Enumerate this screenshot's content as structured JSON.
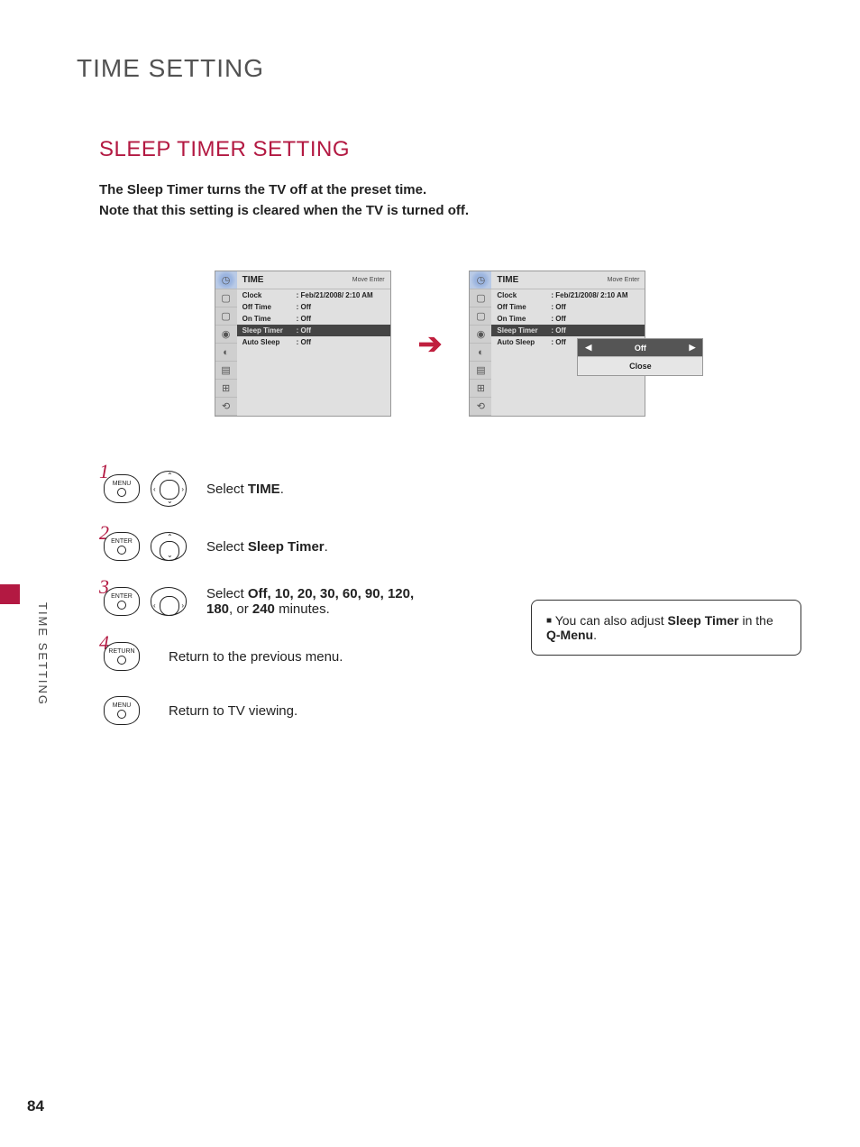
{
  "page_number": "84",
  "title": "TIME SETTING",
  "subtitle": "SLEEP TIMER SETTING",
  "side_label": "TIME SETTING",
  "description_line1": "The Sleep Timer turns the TV off at the preset time.",
  "description_line2": "Note that this setting is cleared when the TV is turned off.",
  "osd": {
    "header": "TIME",
    "header_nav": "Move    Enter",
    "rows": [
      {
        "label": "Clock",
        "value": "Feb/21/2008/ 2:10 AM"
      },
      {
        "label": "Off Time",
        "value": "Off"
      },
      {
        "label": "On Time",
        "value": "Off"
      },
      {
        "label": "Sleep Timer",
        "value": "Off"
      },
      {
        "label": "Auto Sleep",
        "value": "Off"
      }
    ]
  },
  "popup": {
    "value": "Off",
    "close": "Close"
  },
  "steps": [
    {
      "num": "1",
      "btn": "MENU",
      "text_pre": "Select ",
      "text_bold": "TIME",
      "text_post": "."
    },
    {
      "num": "2",
      "btn": "ENTER",
      "text_pre": "Select ",
      "text_bold": "Sleep Timer",
      "text_post": "."
    },
    {
      "num": "3",
      "btn": "ENTER",
      "text_pre": "Select ",
      "text_bold": "Off, 10, 20, 30, 60, 90, 120, 180",
      "text_mid": ", or ",
      "text_bold2": "240",
      "text_post": " minutes."
    },
    {
      "num": "4",
      "btn": "RETURN",
      "text_pre": "Return to the previous menu."
    }
  ],
  "step_menu": {
    "btn": "MENU",
    "text": "Return to TV viewing."
  },
  "note": {
    "pre": "You can also adjust ",
    "bold1": "Sleep Timer",
    "mid": " in the ",
    "bold2": "Q-Menu",
    "post": "."
  }
}
